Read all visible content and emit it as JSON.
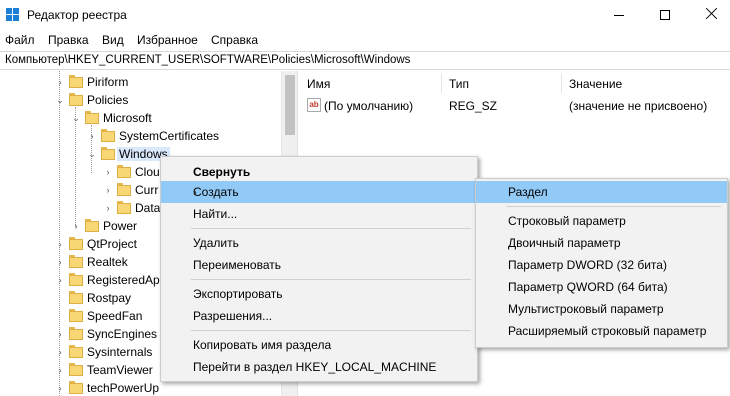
{
  "window": {
    "title": "Редактор реестра",
    "minimize_label": "",
    "maximize_label": "",
    "close_label": ""
  },
  "menubar": [
    "Файл",
    "Правка",
    "Вид",
    "Избранное",
    "Справка"
  ],
  "address": "Компьютер\\HKEY_CURRENT_USER\\SOFTWARE\\Policies\\Microsoft\\Windows",
  "tree": [
    {
      "label": "Piriform",
      "expander": "›"
    },
    {
      "label": "Policies",
      "expander": "⌄"
    },
    {
      "label": "Microsoft",
      "expander": "⌄"
    },
    {
      "label": "SystemCertificates",
      "expander": "›"
    },
    {
      "label": "Windows",
      "expander": "⌄"
    },
    {
      "label": "Clou",
      "expander": "›"
    },
    {
      "label": "Curr",
      "expander": "›"
    },
    {
      "label": "Data",
      "expander": "›"
    },
    {
      "label": "Power",
      "expander": "›"
    },
    {
      "label": "QtProject",
      "expander": "›"
    },
    {
      "label": "Realtek",
      "expander": "›"
    },
    {
      "label": "RegisteredAp",
      "expander": "›"
    },
    {
      "label": "Rostpay",
      "expander": ""
    },
    {
      "label": "SpeedFan",
      "expander": ""
    },
    {
      "label": "SyncEngines",
      "expander": "›"
    },
    {
      "label": "Sysinternals",
      "expander": "›"
    },
    {
      "label": "TeamViewer",
      "expander": "›"
    },
    {
      "label": "techPowerUp",
      "expander": "›"
    }
  ],
  "columns": {
    "name": "Имя",
    "type": "Тип",
    "value": "Значение"
  },
  "values": [
    {
      "icon": "ab",
      "name": "(По умолчанию)",
      "type": "REG_SZ",
      "value": "(значение не присвоено)"
    }
  ],
  "context_menu": {
    "items": [
      "Свернуть",
      "Создать",
      "Найти...",
      "Удалить",
      "Переименовать",
      "Экспортировать",
      "Разрешения...",
      "Копировать имя раздела",
      "Перейти в раздел HKEY_LOCAL_MACHINE"
    ],
    "submenu_arrow": "›"
  },
  "submenu": {
    "items": [
      "Раздел",
      "Строковый параметр",
      "Двоичный параметр",
      "Параметр DWORD (32 бита)",
      "Параметр QWORD (64 бита)",
      "Мультистроковый параметр",
      "Расширяемый строковый параметр"
    ]
  },
  "colors": {
    "highlight": "#91c9f7",
    "menu_bg": "#f2f2f2",
    "folder": "#f8d775"
  }
}
